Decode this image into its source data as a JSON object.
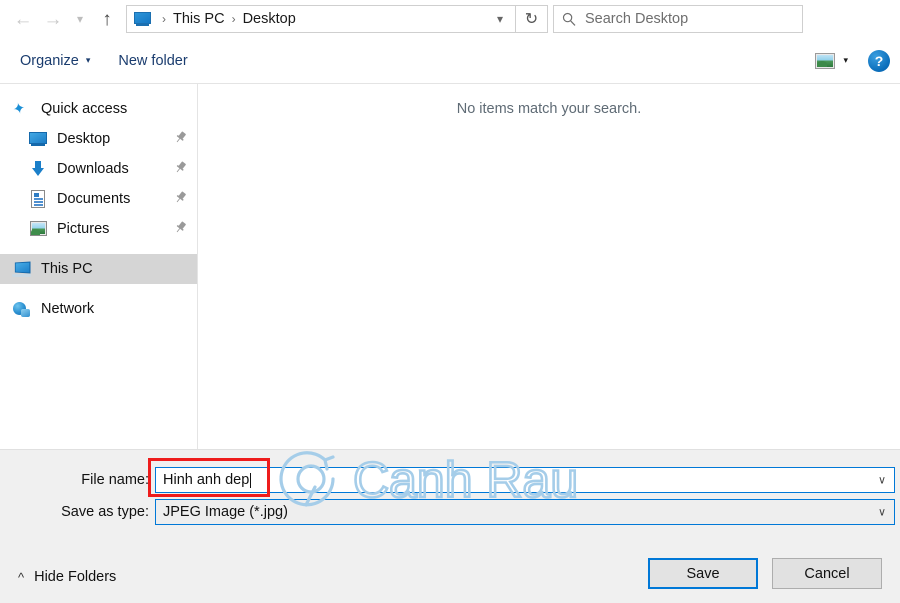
{
  "navigation": {
    "back_icon": "arrow-left-icon",
    "forward_icon": "arrow-right-icon",
    "recent_icon": "chevron-down-icon",
    "up_icon": "arrow-up-icon",
    "breadcrumbs": [
      "This PC",
      "Desktop"
    ],
    "breadcrumb_separator": "›",
    "address_dropdown_icon": "chevron-down-icon",
    "refresh_icon": "refresh-icon",
    "refresh_glyph": "↻"
  },
  "search": {
    "placeholder": "Search Desktop",
    "icon": "search-icon",
    "value": ""
  },
  "toolbar": {
    "organize_label": "Organize",
    "organize_caret": "▾",
    "new_folder_label": "New folder",
    "view_icon": "picture-view-icon",
    "view_caret": "▾",
    "help_label": "?",
    "help_icon": "help-icon"
  },
  "sidebar": {
    "items": [
      {
        "label": "Quick access",
        "icon": "star-icon",
        "indent": false,
        "pinned": false,
        "selected": false
      },
      {
        "label": "Desktop",
        "icon": "monitor-icon",
        "indent": true,
        "pinned": true,
        "selected": false
      },
      {
        "label": "Downloads",
        "icon": "download-arrow-icon",
        "indent": true,
        "pinned": true,
        "selected": false
      },
      {
        "label": "Documents",
        "icon": "document-icon",
        "indent": true,
        "pinned": true,
        "selected": false
      },
      {
        "label": "Pictures",
        "icon": "picture-icon",
        "indent": true,
        "pinned": true,
        "selected": false
      },
      {
        "label": "This PC",
        "icon": "this-pc-icon",
        "indent": false,
        "pinned": false,
        "selected": true
      },
      {
        "label": "Network",
        "icon": "network-icon",
        "indent": false,
        "pinned": false,
        "selected": false
      }
    ],
    "pin_glyph": "📌"
  },
  "file_list": {
    "empty_message": "No items match your search.",
    "items": []
  },
  "watermark": {
    "text": "Canh Rau",
    "color": "#a8cfe8"
  },
  "form": {
    "file_name_label": "File name:",
    "file_name_value": "Hinh anh dep",
    "save_as_type_label": "Save as type:",
    "save_as_type_value": "JPEG Image (*.jpg)",
    "dropdown_icon": "chevron-down-icon",
    "dropdown_glyph": "∨"
  },
  "annotation": {
    "color": "#ee1c1c",
    "target": "file-name-input"
  },
  "buttons": {
    "save_label": "Save",
    "cancel_label": "Cancel",
    "hide_folders_label": "Hide Folders",
    "hide_folders_caret": "⌃"
  },
  "colors": {
    "accent": "#0078d7",
    "footer_bg": "#f0f0f0",
    "selection_bg": "#d5d5d5"
  }
}
